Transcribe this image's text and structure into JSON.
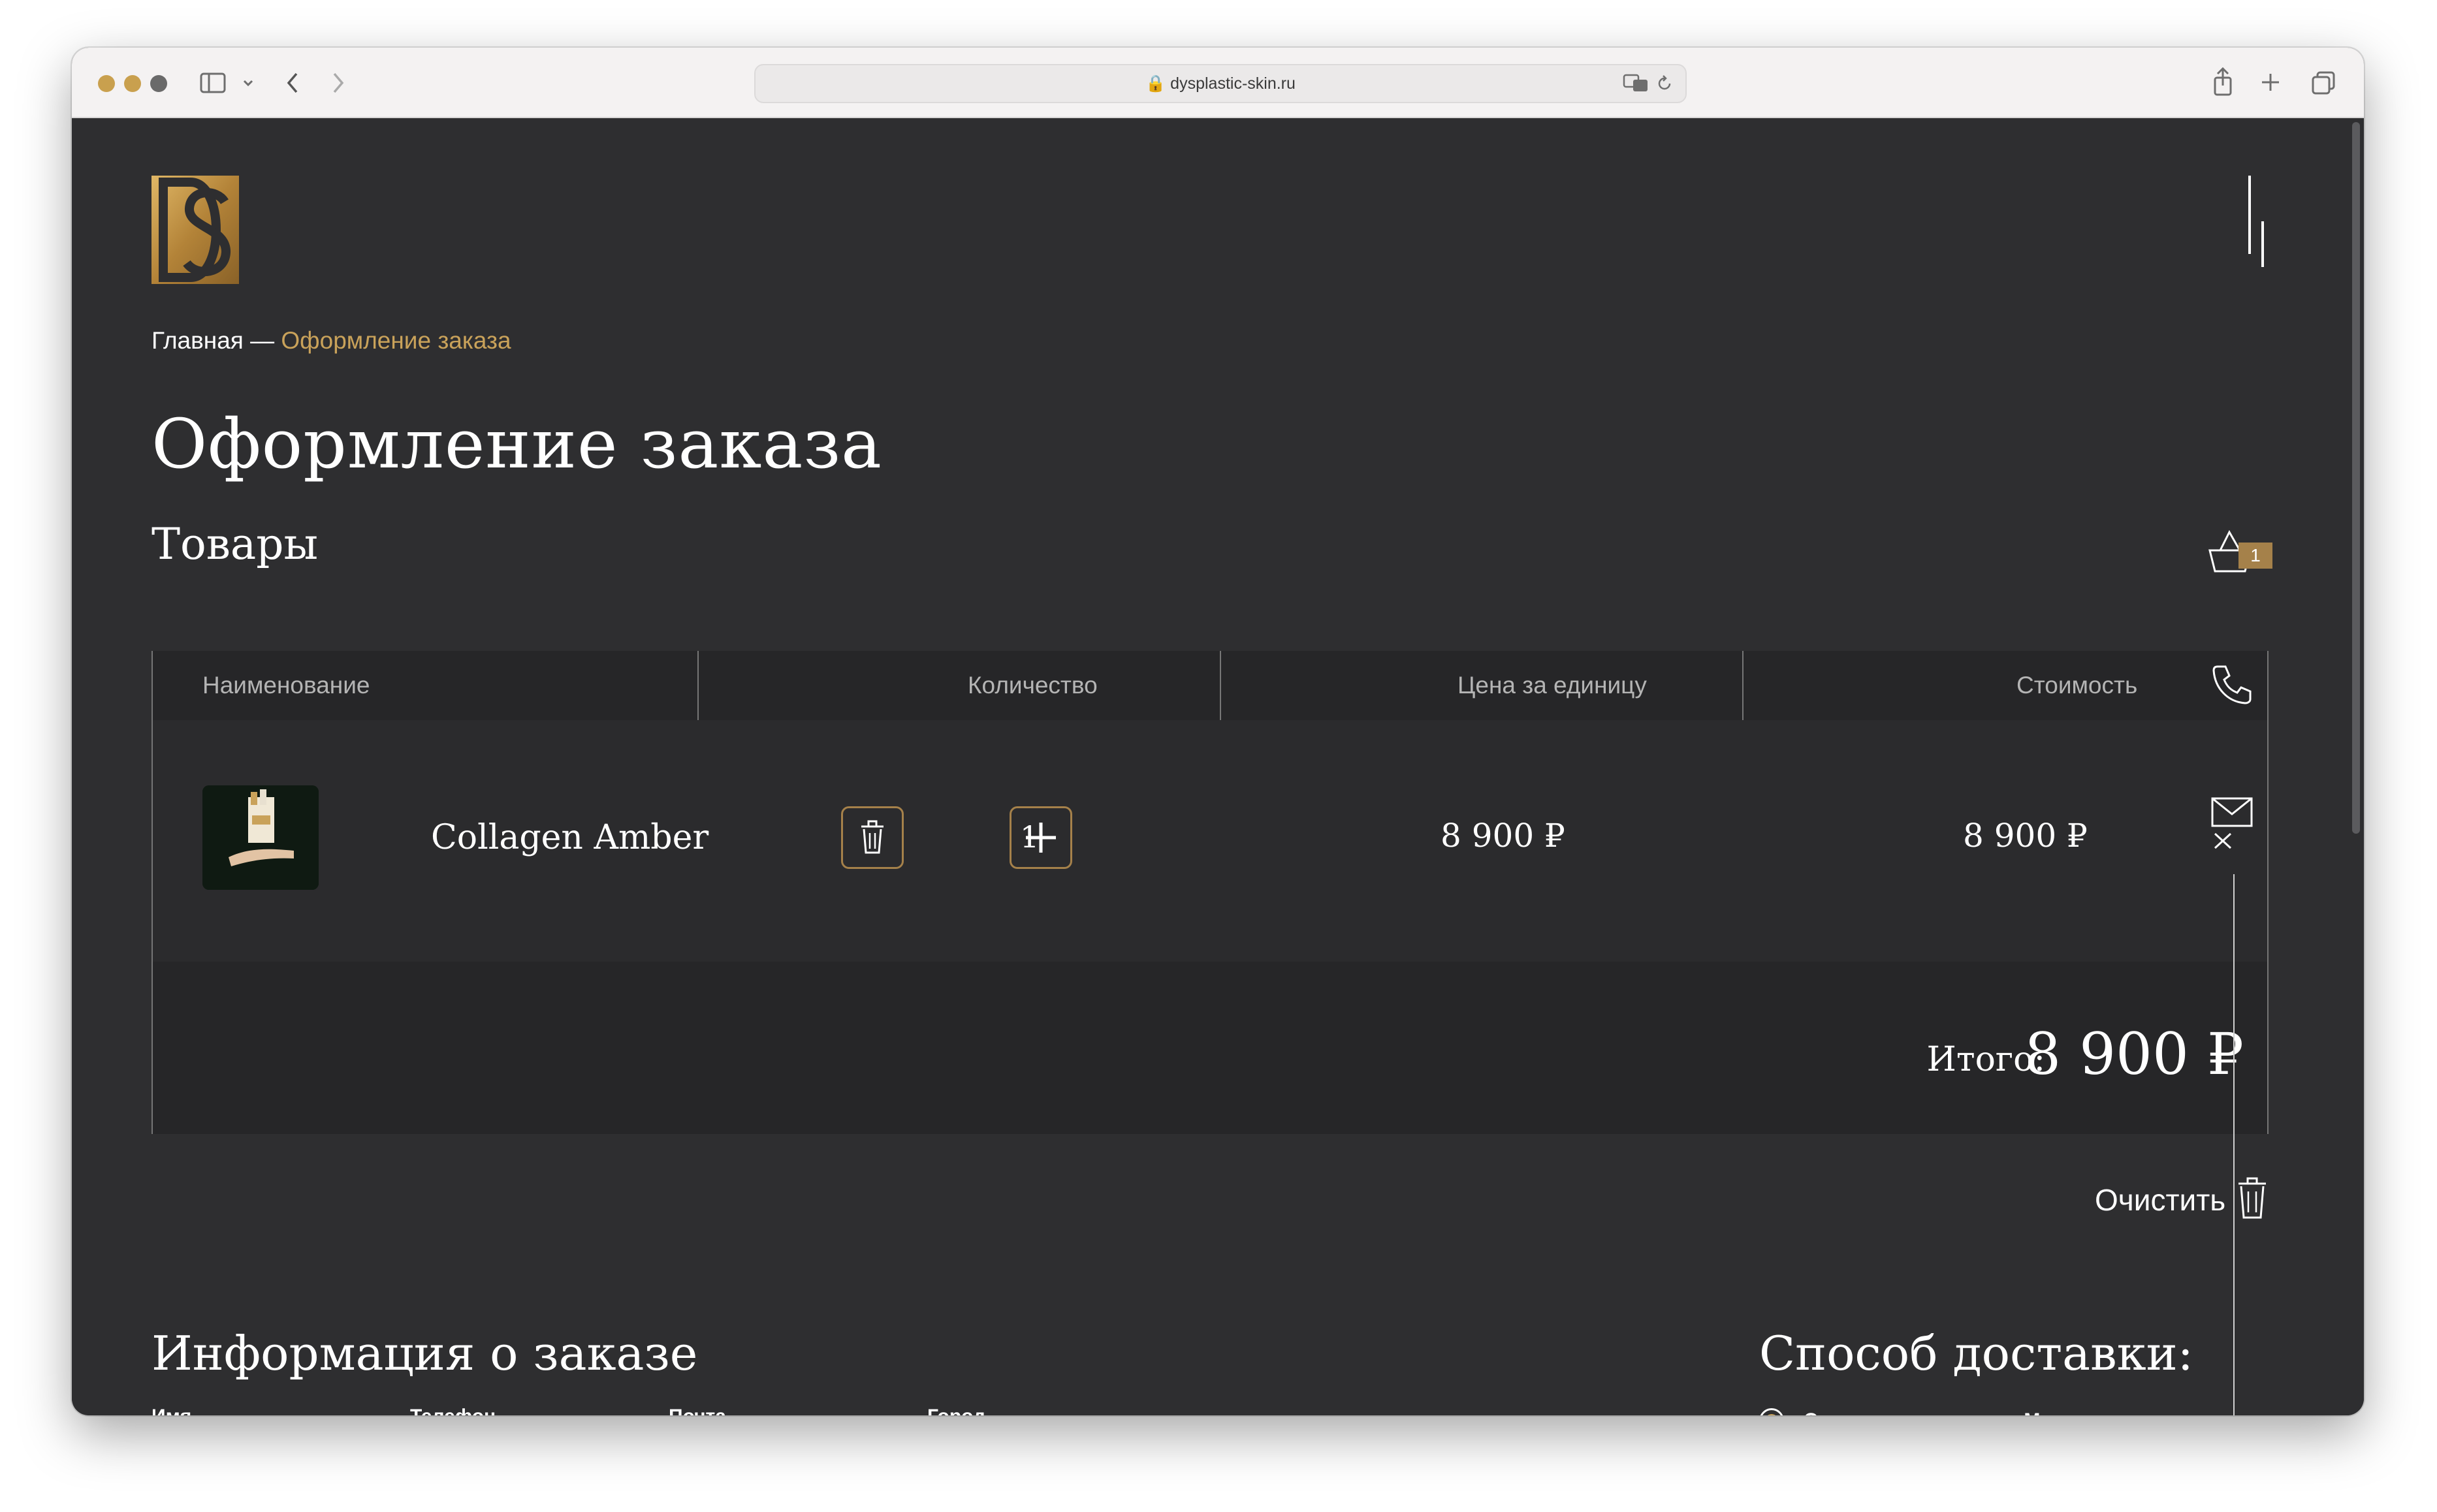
{
  "browser": {
    "url": "dysplastic-skin.ru",
    "traffic_lights": [
      "#c9a04e",
      "#c9a04e",
      "#6a6a6a"
    ]
  },
  "breadcrumb": {
    "home": "Главная",
    "separator": " — ",
    "current": "Оформление заказа"
  },
  "page_title": "Оформление заказа",
  "section_title": "Товары",
  "table": {
    "headers": [
      "Наименование",
      "Количество",
      "Цена за единицу",
      "Стоимость"
    ],
    "rows": [
      {
        "name": "Collagen Amber",
        "quantity": "1",
        "unit_price": "8 900 ₽",
        "cost": "8 900 ₽"
      }
    ],
    "total_label": "Итого:",
    "total_value": "8 900 ₽"
  },
  "clear_label": "Очистить",
  "cart_count": "1",
  "order_info": {
    "title": "Информация о заказе",
    "fields": [
      "Имя",
      "Телефон",
      "Почта",
      "Город"
    ]
  },
  "delivery": {
    "title": "Способ доставки:",
    "options": [
      {
        "label": "Самовывоз со склада Москвы",
        "selected": true
      }
    ]
  },
  "colors": {
    "accent": "#c9a25a",
    "accent_dark": "#a5814a",
    "background": "#2e2e30"
  }
}
